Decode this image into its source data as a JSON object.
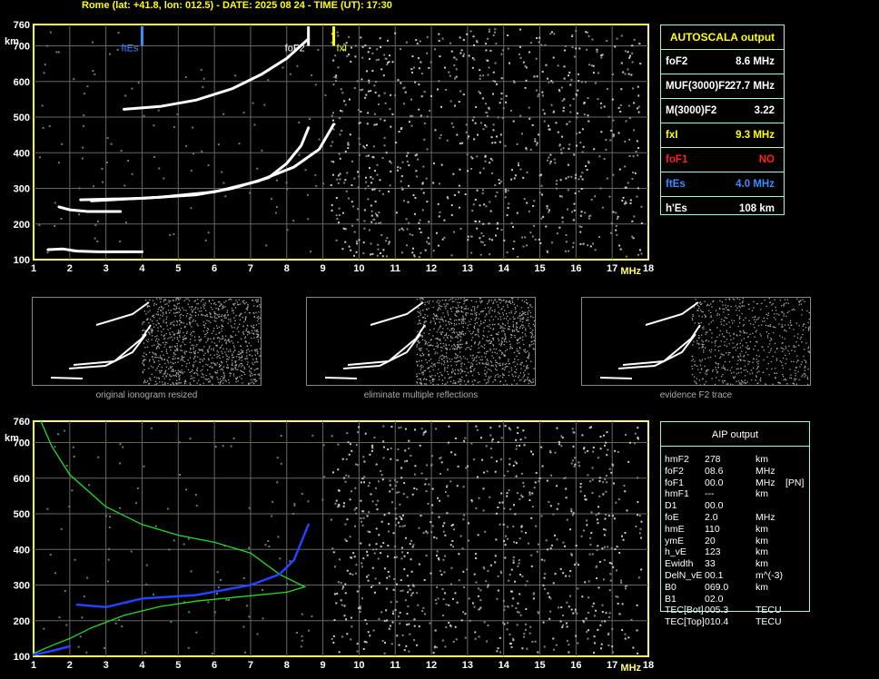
{
  "header": "Rome (lat: +41.8, lon: 012.5) - DATE: 2025 08 24 - TIME (UT): 17:30",
  "chart_data": [
    {
      "type": "scatter",
      "name": "ionogram-top",
      "xlim": [
        1,
        18
      ],
      "ylim": [
        100,
        760
      ],
      "xlabel": "MHz",
      "ylabel": "km",
      "x_ticks": [
        1,
        2,
        3,
        4,
        5,
        6,
        7,
        8,
        9,
        10,
        11,
        12,
        13,
        14,
        15,
        16,
        17,
        18
      ],
      "y_ticks": [
        100,
        200,
        300,
        400,
        500,
        600,
        700,
        760
      ],
      "grid": true,
      "markers": [
        {
          "label": "ftEs",
          "x": 4.0,
          "color": "#3a8cff"
        },
        {
          "label": "foF2",
          "x": 8.6,
          "color": "#ffffff"
        },
        {
          "label": "fxI",
          "x": 9.3,
          "color": "#ffff00"
        }
      ],
      "traces": [
        {
          "name": "Es",
          "color": "#ffffff",
          "points": [
            [
              1.4,
              128
            ],
            [
              1.8,
              130
            ],
            [
              2.2,
              124
            ],
            [
              2.8,
              122
            ],
            [
              3.4,
              122
            ],
            [
              4.0,
              122
            ]
          ]
        },
        {
          "name": "Es-2",
          "color": "#ffffff",
          "points": [
            [
              1.7,
              248
            ],
            [
              2.0,
              240
            ],
            [
              2.5,
              235
            ],
            [
              3.0,
              235
            ],
            [
              3.4,
              235
            ]
          ]
        },
        {
          "name": "F2-o",
          "color": "#ffffff",
          "points": [
            [
              2.3,
              268
            ],
            [
              4.0,
              272
            ],
            [
              5.5,
              282
            ],
            [
              6.5,
              300
            ],
            [
              7.5,
              330
            ],
            [
              8.0,
              370
            ],
            [
              8.4,
              420
            ],
            [
              8.6,
              470
            ]
          ]
        },
        {
          "name": "F2-x",
          "color": "#ffffff",
          "points": [
            [
              2.6,
              265
            ],
            [
              4.5,
              275
            ],
            [
              6.0,
              290
            ],
            [
              7.2,
              320
            ],
            [
              8.2,
              360
            ],
            [
              8.9,
              410
            ],
            [
              9.3,
              480
            ]
          ]
        },
        {
          "name": "F2-2hop",
          "color": "#ffffff",
          "points": [
            [
              3.5,
              522
            ],
            [
              4.5,
              530
            ],
            [
              5.5,
              548
            ],
            [
              6.5,
              580
            ],
            [
              7.3,
              620
            ],
            [
              8.0,
              665
            ],
            [
              8.6,
              720
            ]
          ]
        }
      ]
    },
    {
      "type": "scatter",
      "name": "ionogram-bottom",
      "xlim": [
        1,
        18
      ],
      "ylim": [
        100,
        760
      ],
      "xlabel": "MHz",
      "ylabel": "km",
      "x_ticks": [
        1,
        2,
        3,
        4,
        5,
        6,
        7,
        8,
        9,
        10,
        11,
        12,
        13,
        14,
        15,
        16,
        17,
        18
      ],
      "y_ticks": [
        100,
        200,
        300,
        400,
        500,
        600,
        700,
        760
      ],
      "grid": true,
      "traces": [
        {
          "name": "profile",
          "color": "#22dd22",
          "points": [
            [
              1.2,
              760
            ],
            [
              1.5,
              690
            ],
            [
              2.0,
              610
            ],
            [
              3.0,
              520
            ],
            [
              4.0,
              470
            ],
            [
              5.0,
              440
            ],
            [
              6.0,
              420
            ],
            [
              7.0,
              390
            ],
            [
              7.8,
              330
            ],
            [
              8.5,
              295
            ],
            [
              8.0,
              280
            ],
            [
              7.0,
              270
            ],
            [
              5.5,
              255
            ],
            [
              4.5,
              240
            ],
            [
              3.5,
              215
            ],
            [
              2.6,
              180
            ],
            [
              2.0,
              150
            ],
            [
              1.5,
              130
            ],
            [
              1.0,
              108
            ]
          ]
        },
        {
          "name": "fit",
          "color": "#2244ff",
          "points": [
            [
              2.2,
              245
            ],
            [
              3.0,
              238
            ],
            [
              4.0,
              262
            ],
            [
              5.5,
              272
            ],
            [
              7.0,
              300
            ],
            [
              7.8,
              330
            ],
            [
              8.2,
              370
            ],
            [
              8.6,
              470
            ]
          ]
        },
        {
          "name": "fit-E",
          "color": "#2244ff",
          "points": [
            [
              1.0,
              104
            ],
            [
              1.5,
              115
            ],
            [
              2.0,
              128
            ]
          ]
        }
      ]
    }
  ],
  "autoscala": {
    "title": "AUTOSCALA output",
    "rows": [
      {
        "k": "foF2",
        "v": "8.6 MHz",
        "color": "#ffffff"
      },
      {
        "k": "MUF(3000)F2",
        "v": "27.7 MHz",
        "color": "#ffffff"
      },
      {
        "k": "M(3000)F2",
        "v": "3.22",
        "color": "#ffffff"
      },
      {
        "k": "fxI",
        "v": "9.3 MHz",
        "color": "#ffff00"
      },
      {
        "k": "foF1",
        "v": "NO",
        "color": "#ff2020"
      },
      {
        "k": "ftEs",
        "v": "4.0 MHz",
        "color": "#3a8cff"
      },
      {
        "k": "h'Es",
        "v": "108    km",
        "color": "#ffffff"
      }
    ]
  },
  "thumbnails": [
    "original ionogram resized",
    "eliminate multiple reflections",
    "evidence F2 trace"
  ],
  "aip": {
    "title": "AIP output",
    "rows": [
      [
        "hmF2",
        "278",
        "km",
        ""
      ],
      [
        "foF2",
        "08.6",
        "MHz",
        ""
      ],
      [
        "foF1",
        "00.0",
        "MHz",
        "[PN]"
      ],
      [
        "hmF1",
        "---",
        "km",
        ""
      ],
      [
        "D1",
        "00.0",
        "",
        ""
      ],
      [
        "foE",
        "2.0",
        "MHz",
        ""
      ],
      [
        "hmE",
        "110",
        "km",
        ""
      ],
      [
        "ymE",
        "20",
        "km",
        ""
      ],
      [
        "h_vE",
        "123",
        "km",
        ""
      ],
      [
        "Ewidth",
        "33",
        "km",
        ""
      ],
      [
        "DelN_vE",
        "00.1",
        "m^(-3)",
        ""
      ],
      [
        "B0",
        "069.0",
        "km",
        ""
      ],
      [
        "B1",
        "02.0",
        "",
        ""
      ],
      [
        "TEC[Bot]",
        "005.3",
        "TECU",
        ""
      ],
      [
        "TEC[Top]",
        "010.4",
        "TECU",
        ""
      ]
    ]
  }
}
